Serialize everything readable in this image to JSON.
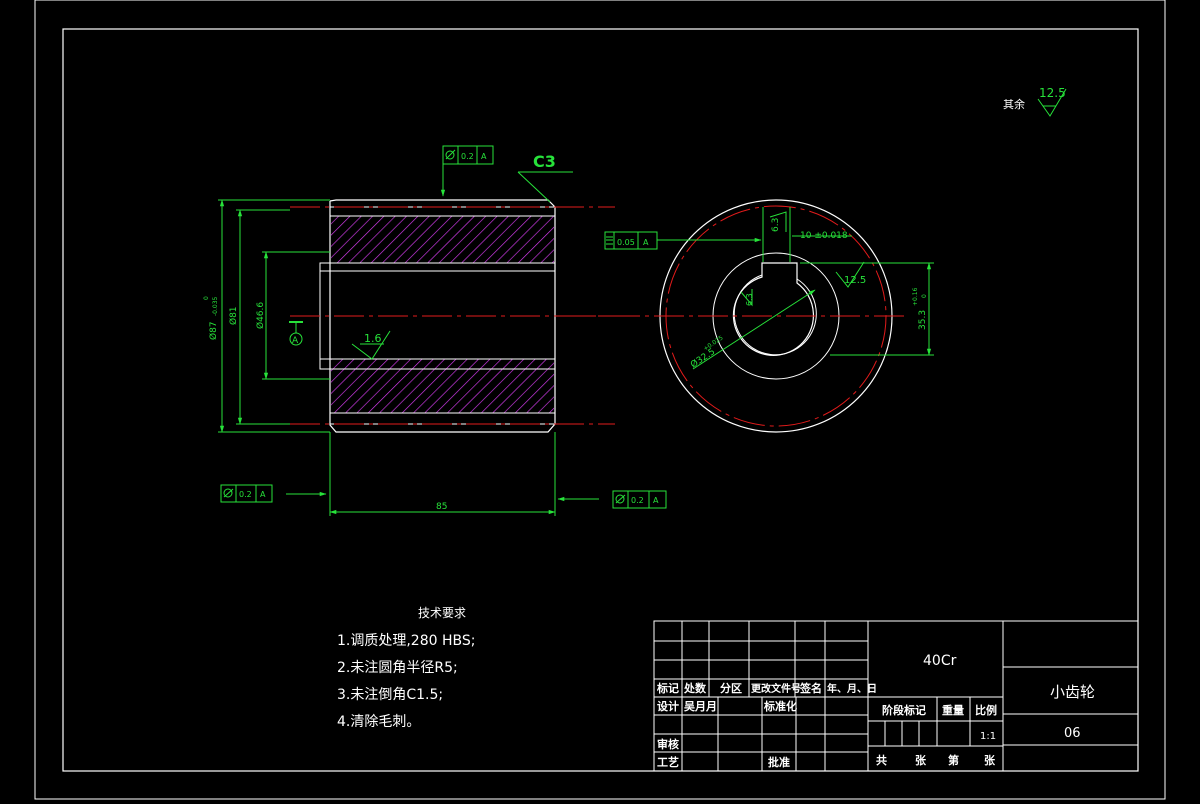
{
  "drawing": {
    "surface_note_label": "其余",
    "surface_note_value": "12.5",
    "chamfer_label": "C3",
    "front_view": {
      "dims": {
        "outer_dia": "Ø87",
        "outer_dia_tol_upper": "0",
        "outer_dia_tol_lower": "-0.035",
        "mid_dia": "Ø81",
        "bore_dia": "Ø46.6",
        "length": "85"
      },
      "roughness_bore": "1.6",
      "datum_symbol": "A",
      "tol_frames": [
        {
          "value": "0.2",
          "datum": "A"
        },
        {
          "value": "0.2",
          "datum": "A"
        },
        {
          "value": "0.2",
          "datum": "A"
        }
      ]
    },
    "side_view": {
      "keyway_width": "10 ±0.018",
      "keyway_depth_label": "6.3",
      "keyway_depth_dim": "35.3",
      "keyway_depth_tol_upper": "+0.16",
      "keyway_depth_tol_lower": "0",
      "bore_dia": "Ø32.5",
      "bore_tol": "+0.025",
      "inner_roughness": "6.3",
      "key_roughness": "12.5",
      "tol_frame": {
        "value": "0.05",
        "datum": "A"
      }
    }
  },
  "tech_requirements": {
    "title": "技术要求",
    "items": [
      "1.调质处理,280 HBS;",
      "2.未注圆角半径R5;",
      "3.未注倒角C1.5;",
      "4.清除毛刺。"
    ]
  },
  "title_block": {
    "material": "40Cr",
    "part_name": "小齿轮",
    "drawing_no": "06",
    "scale": "1:1",
    "labels": {
      "mark": "标记",
      "count": "处数",
      "zone": "分区",
      "change_doc": "更改文件号",
      "sign": "签名",
      "date": "年、月、日",
      "design": "设计",
      "designer": "吴月月",
      "standard": "标准化",
      "stage": "阶段标记",
      "weight": "重量",
      "scale_label": "比例",
      "review": "审核",
      "process": "工艺",
      "approve": "批准",
      "total": "共",
      "sheets": "张",
      "page": "第",
      "sheet": "张"
    }
  },
  "colors": {
    "line": "#ffffff",
    "dim": "#27e23a",
    "center": "#e21b1b",
    "hatch": "#d63cf0"
  }
}
